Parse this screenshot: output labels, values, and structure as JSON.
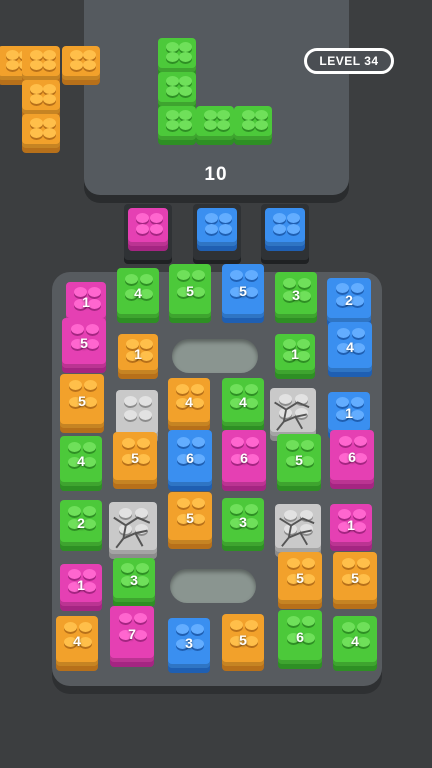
{
  "hud": {
    "level_label": "LEVEL 34",
    "pieces_remaining": "10"
  },
  "colors": {
    "green": {
      "base": "#4cc93a",
      "light": "#6fe05a",
      "shade": "#2e8f24"
    },
    "orange": {
      "base": "#f2a12b",
      "light": "#ffbf4a",
      "shade": "#b7701a"
    },
    "blue": {
      "base": "#3a8ff0",
      "light": "#63adff",
      "shade": "#1f5fb2"
    },
    "pink": {
      "base": "#e540b3",
      "light": "#ff66cf",
      "shade": "#a52582"
    },
    "gray": {
      "base": "#c9c9c9",
      "light": "#e2e2e2",
      "shade": "#8c8c8c"
    }
  },
  "active_piece": {
    "color": "green",
    "shape": "L"
  },
  "queued_piece": {
    "color": "orange",
    "shape": "T"
  },
  "queue_slots": [
    {
      "color": "pink"
    },
    {
      "color": "blue"
    },
    {
      "color": "blue"
    }
  ],
  "board_blocks": [
    {
      "color": "pink",
      "value": "1"
    },
    {
      "color": "green",
      "value": "4"
    },
    {
      "color": "green",
      "value": "5"
    },
    {
      "color": "blue",
      "value": "5"
    },
    {
      "color": "green",
      "value": "3"
    },
    {
      "color": "blue",
      "value": "2"
    },
    {
      "color": "pink",
      "value": "5"
    },
    {
      "color": "orange",
      "value": "1"
    },
    {
      "color": "green",
      "value": "1"
    },
    {
      "color": "blue",
      "value": "4"
    },
    {
      "color": "orange",
      "value": "5"
    },
    {
      "color": "gray",
      "value": ""
    },
    {
      "color": "orange",
      "value": "4"
    },
    {
      "color": "green",
      "value": "4"
    },
    {
      "color": "gray",
      "value": "",
      "cracked": true
    },
    {
      "color": "blue",
      "value": "1"
    },
    {
      "color": "green",
      "value": "4"
    },
    {
      "color": "orange",
      "value": "5"
    },
    {
      "color": "blue",
      "value": "6"
    },
    {
      "color": "pink",
      "value": "6"
    },
    {
      "color": "green",
      "value": "5"
    },
    {
      "color": "pink",
      "value": "6"
    },
    {
      "color": "green",
      "value": "2"
    },
    {
      "color": "gray",
      "value": "",
      "cracked": true
    },
    {
      "color": "orange",
      "value": "5"
    },
    {
      "color": "green",
      "value": "3"
    },
    {
      "color": "gray",
      "value": "",
      "cracked": true
    },
    {
      "color": "pink",
      "value": "1"
    },
    {
      "color": "pink",
      "value": "1"
    },
    {
      "color": "green",
      "value": "3"
    },
    {
      "color": "orange",
      "value": "5"
    },
    {
      "color": "orange",
      "value": "5"
    },
    {
      "color": "orange",
      "value": "4"
    },
    {
      "color": "pink",
      "value": "7"
    },
    {
      "color": "blue",
      "value": "3"
    },
    {
      "color": "orange",
      "value": "5"
    },
    {
      "color": "green",
      "value": "6"
    },
    {
      "color": "green",
      "value": "4"
    }
  ],
  "obstacles": [
    {
      "label": ""
    },
    {
      "label": ""
    }
  ]
}
